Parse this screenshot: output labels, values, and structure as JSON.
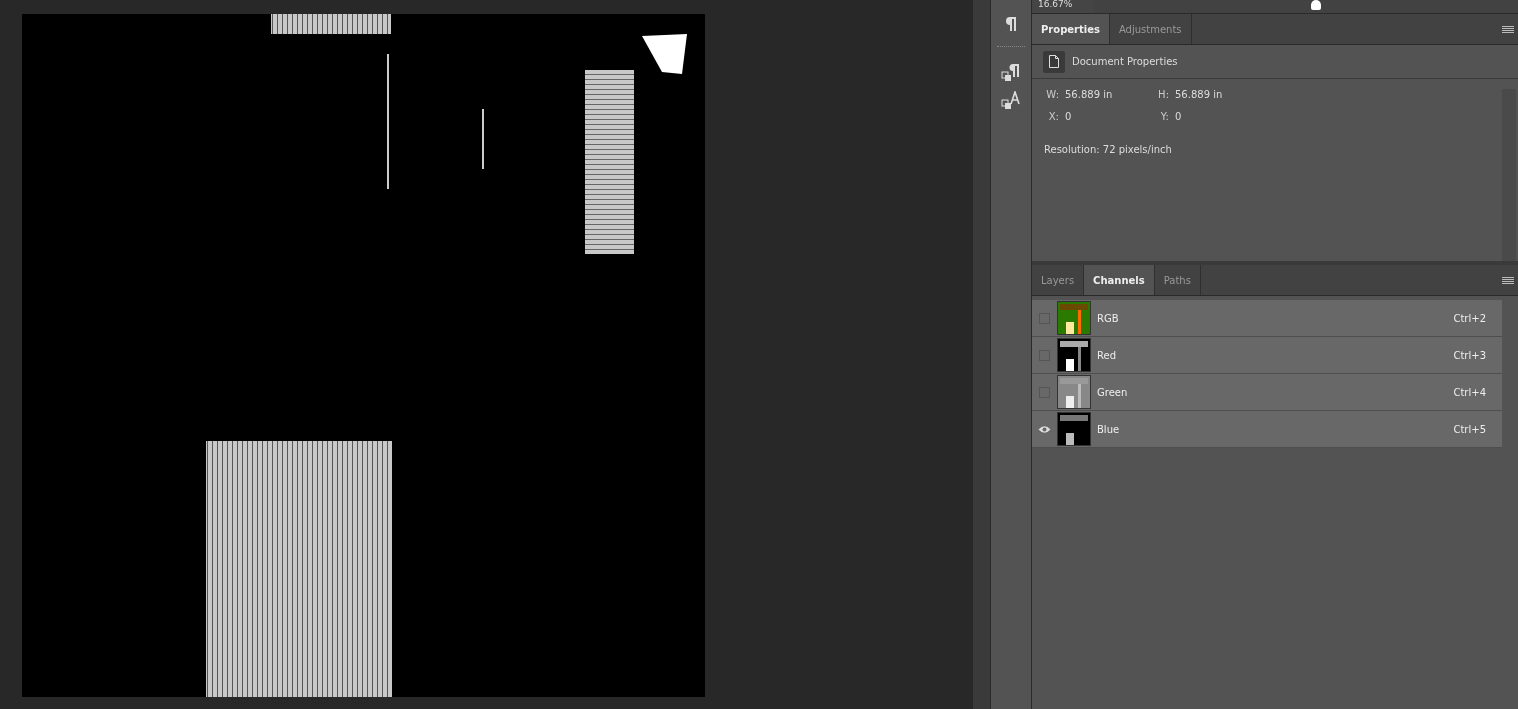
{
  "zoom": {
    "value": "16.67%",
    "level": 0.5
  },
  "properties_panel": {
    "tabs": [
      {
        "label": "Properties",
        "selected": true
      },
      {
        "label": "Adjustments",
        "selected": false
      }
    ],
    "header": "Document Properties",
    "fields": [
      {
        "label": "W:",
        "value": "56.889 in"
      },
      {
        "label": "H:",
        "value": "56.889 in"
      },
      {
        "label": "X:",
        "value": "0"
      },
      {
        "label": "Y:",
        "value": "0"
      }
    ],
    "resolution": "Resolution: 72 pixels/inch"
  },
  "channels_panel": {
    "tabs": [
      {
        "label": "Layers",
        "selected": false
      },
      {
        "label": "Channels",
        "selected": true
      },
      {
        "label": "Paths",
        "selected": false
      }
    ],
    "channels": [
      {
        "kind": "rgb",
        "name": "RGB",
        "shortcut": "Ctrl+2",
        "visible": false
      },
      {
        "kind": "red",
        "name": "Red",
        "shortcut": "Ctrl+3",
        "visible": false
      },
      {
        "kind": "green",
        "name": "Green",
        "shortcut": "Ctrl+4",
        "visible": false
      },
      {
        "kind": "blue",
        "name": "Blue",
        "shortcut": "Ctrl+5",
        "visible": true
      }
    ]
  }
}
